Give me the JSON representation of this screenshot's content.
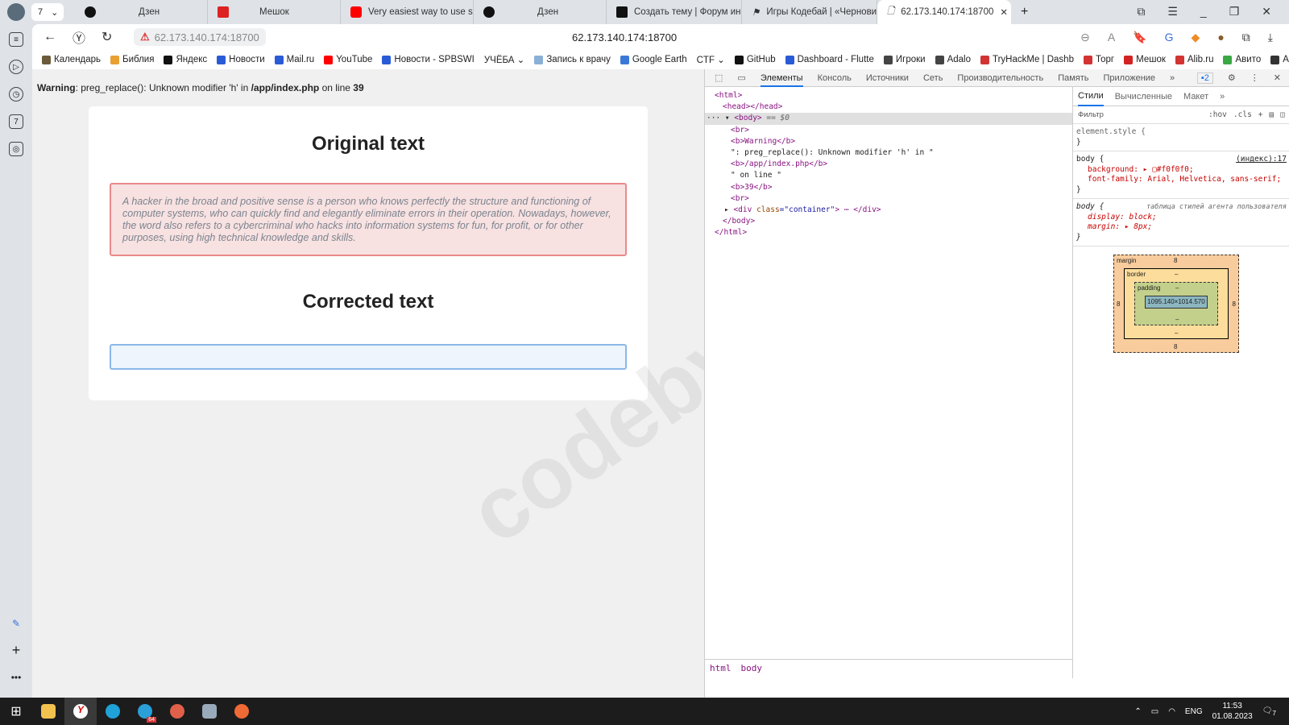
{
  "browser": {
    "tab_count": "7",
    "tabs": [
      {
        "title": "Дзен",
        "icon": "dzen-icon",
        "color": "#111111"
      },
      {
        "title": "Мешок",
        "icon": "meshok-icon",
        "color": "#d22222"
      },
      {
        "title": "Very easiest way to use scr",
        "icon": "youtube-icon",
        "color": "#ff0000"
      },
      {
        "title": "Дзен",
        "icon": "dzen-icon",
        "color": "#111111"
      },
      {
        "title": "Создать тему | Форум инф",
        "icon": "codeby-icon",
        "color": "#222222"
      },
      {
        "title": "Игры Кодебай | «Чернови",
        "icon": "flag-icon",
        "color": "#222222"
      },
      {
        "title": "62.173.140.174:18700",
        "icon": "page-icon",
        "color": "#ffffff",
        "active": true
      }
    ],
    "url": "62.173.140.174:18700",
    "page_title": "62.173.140.174:18700",
    "bookmarks": [
      {
        "label": "Календарь",
        "color": "#6b5b3a"
      },
      {
        "label": "Библия",
        "color": "#e8a030"
      },
      {
        "label": "Яндекс",
        "color": "#111111"
      },
      {
        "label": "Новости",
        "color": "#2a5bd7"
      },
      {
        "label": "Mail.ru",
        "color": "#2a5bd7"
      },
      {
        "label": "YouTube",
        "color": "#ff0000"
      },
      {
        "label": "Новости - SPBSWI",
        "color": "#2a5bd7"
      },
      {
        "label": "УЧЁБА ⌄",
        "color": ""
      },
      {
        "label": "Запись к врачу",
        "color": "#8ab0d8"
      },
      {
        "label": "Google Earth",
        "color": "#3a78d8"
      },
      {
        "label": "CTF ⌄",
        "color": ""
      },
      {
        "label": "GitHub",
        "color": "#111111"
      },
      {
        "label": "Dashboard - Flutte",
        "color": "#2a5bd7"
      },
      {
        "label": "Игроки",
        "color": "#444444"
      },
      {
        "label": "Adalo",
        "color": "#444444"
      },
      {
        "label": "TryHackMe | Dashb",
        "color": "#d33333"
      },
      {
        "label": "Торг",
        "color": "#d33333"
      },
      {
        "label": "Мешок",
        "color": "#d22222"
      },
      {
        "label": "Alib.ru",
        "color": "#d33333"
      },
      {
        "label": "Авито",
        "color": "#3aa845"
      },
      {
        "label": "Арба",
        "color": "#333333"
      }
    ]
  },
  "page": {
    "warning": {
      "label": "Warning",
      "msg": ": preg_replace(): Unknown modifier 'h' in ",
      "file": "/app/index.php",
      "mid": " on line ",
      "line": "39"
    },
    "original_heading": "Original text",
    "original_text": "A hacker in the broad and positive sense is a person who knows perfectly the structure and functioning of computer systems, who can quickly find and elegantly eliminate errors in their operation. Nowadays, however, the word also refers to a cybercriminal who hacks into information systems for fun, for profit, or for other purposes, using high technical knowledge and skills.",
    "corrected_heading": "Corrected text",
    "corrected_value": "",
    "watermark": "codeby.net"
  },
  "devtools": {
    "tabs": [
      "Элементы",
      "Консоль",
      "Источники",
      "Сеть",
      "Производительность",
      "Память",
      "Приложение"
    ],
    "issues": "2",
    "dom": {
      "l1": "<html>",
      "l2": "<head></head>",
      "l3": "<body>",
      "l3b": " == $0",
      "l4": "<br>",
      "l5": "<b>Warning</b>",
      "l6": "\": preg_replace(): Unknown modifier 'h' in \"",
      "l7": "<b>/app/index.php</b>",
      "l8": "\" on line \"",
      "l9": "<b>39</b>",
      "l10": "<br>",
      "l11a": "<div ",
      "l11b": "class",
      "l11c": "=\"container\"",
      "l11d": "> ⋯ </div>",
      "l12": "</body>",
      "l13": "</html>"
    },
    "styles_tabs": [
      "Стили",
      "Вычисленные",
      "Макет"
    ],
    "filter_placeholder": "Фильтр",
    "hov": ":hov",
    "cls": ".cls",
    "rules": {
      "r1": "element.style {",
      "close": "}",
      "r2": "body {",
      "r2src": "(индекс):17",
      "r2p1": "background: ▸ ▢#f0f0f0;",
      "r2p2": "font-family: Arial, Helvetica, sans-serif;",
      "r3": "body {",
      "r3src": "таблица стилей агента пользователя",
      "r3p1": "display: block;",
      "r3p2": "margin: ▸ 8px;"
    },
    "box": {
      "margin": "margin",
      "border": "border",
      "padding": "padding",
      "content": "1095.140×1014.570",
      "m": "8",
      "dash": "–"
    },
    "crumbs": [
      "html",
      "body"
    ]
  },
  "taskbar": {
    "lang": "ENG",
    "time": "11:53",
    "date": "01.08.2023",
    "telegram_badge": "64",
    "notif": "7"
  }
}
